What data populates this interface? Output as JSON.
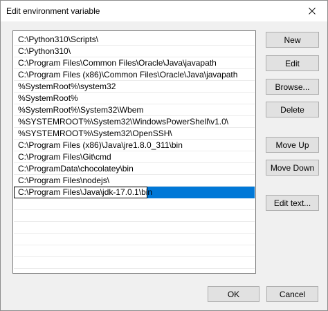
{
  "window": {
    "title": "Edit environment variable"
  },
  "path_entries": [
    "C:\\Python310\\Scripts\\",
    "C:\\Python310\\",
    "C:\\Program Files\\Common Files\\Oracle\\Java\\javapath",
    "C:\\Program Files (x86)\\Common Files\\Oracle\\Java\\javapath",
    "%SystemRoot%\\system32",
    "%SystemRoot%",
    "%SystemRoot%\\System32\\Wbem",
    "%SYSTEMROOT%\\System32\\WindowsPowerShell\\v1.0\\",
    "%SYSTEMROOT%\\System32\\OpenSSH\\",
    "C:\\Program Files (x86)\\Java\\jre1.8.0_311\\bin",
    "C:\\Program Files\\Git\\cmd",
    "C:\\ProgramData\\chocolatey\\bin",
    "C:\\Program Files\\nodejs\\",
    "C:\\Program Files\\Java\\jdk-17.0.1\\bin"
  ],
  "selected_index": 13,
  "buttons": {
    "new": "New",
    "edit": "Edit",
    "browse": "Browse...",
    "delete": "Delete",
    "move_up": "Move Up",
    "move_down": "Move Down",
    "edit_text": "Edit text...",
    "ok": "OK",
    "cancel": "Cancel"
  },
  "colors": {
    "selection": "#0078d7",
    "dialog_bg": "#f0f0f0",
    "button_bg": "#e1e1e1"
  }
}
